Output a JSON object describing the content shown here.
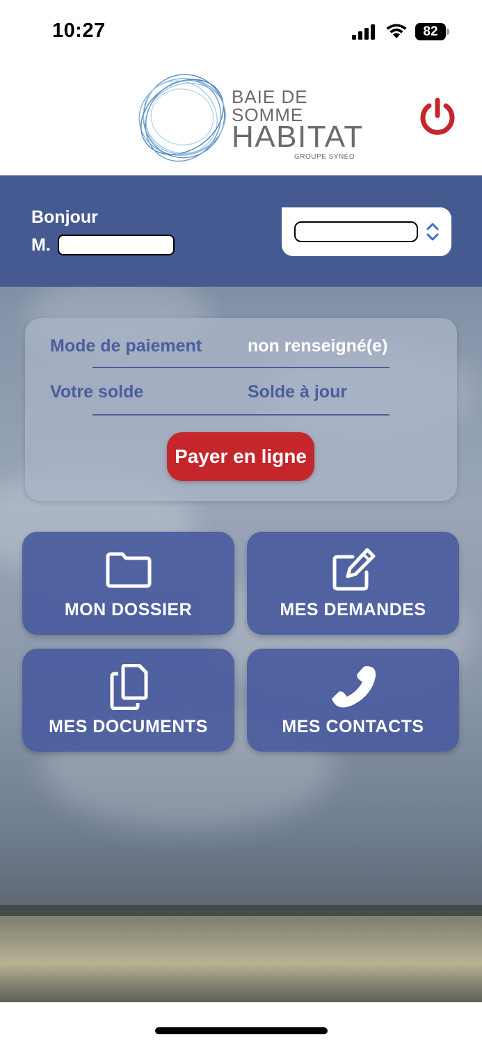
{
  "status_bar": {
    "time": "10:27",
    "battery": "82",
    "icons": [
      "signal-icon",
      "wifi-icon",
      "battery-icon"
    ]
  },
  "header": {
    "logo": {
      "line1": "BAIE DE SOMME",
      "line2": "HABITAT",
      "line3": "GROUPE SYNÉO"
    },
    "power_icon": "power-icon",
    "power_color": "#c5262b"
  },
  "greeting": {
    "hello": "Bonjour",
    "title": "M."
  },
  "payment": {
    "mode_label": "Mode de paiement",
    "mode_value": "non renseigné(e)",
    "balance_label": "Votre solde",
    "balance_value": "Solde à jour",
    "pay_button": "Payer en ligne"
  },
  "tiles": [
    {
      "label": "MON DOSSIER",
      "icon": "folder-icon"
    },
    {
      "label": "MES DEMANDES",
      "icon": "edit-icon"
    },
    {
      "label": "MES DOCUMENTS",
      "icon": "documents-icon"
    },
    {
      "label": "MES CONTACTS",
      "icon": "phone-icon"
    }
  ],
  "colors": {
    "primary": "#465a92",
    "accent_red": "#c5262b",
    "label_blue": "#4a5e9c"
  }
}
